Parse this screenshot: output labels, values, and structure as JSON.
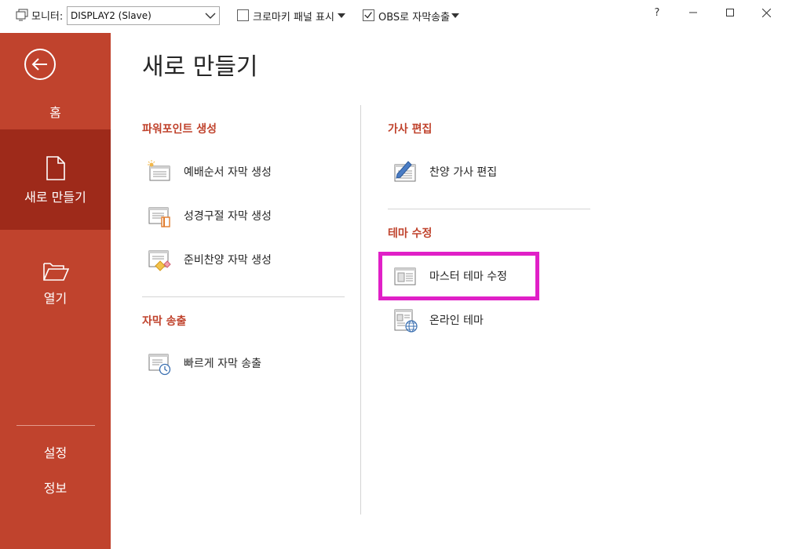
{
  "toolbar": {
    "monitor_label": "모니터:",
    "display_select": "DISPLAY2 (Slave)",
    "chroma_label": "크로마키 패널 표시",
    "chroma_checked": false,
    "obs_label": "OBS로 자막송출",
    "obs_checked": true,
    "icons": [
      "monitor-icon",
      "chevron-down-icon",
      "caret-down-icon"
    ]
  },
  "window": {
    "help": "?",
    "minimize": "minimize-icon",
    "maximize": "maximize-icon",
    "close": "close-icon"
  },
  "sidebar": {
    "back_icon": "back-arrow-icon",
    "home": "홈",
    "new": "새로 만들기",
    "open": "열기",
    "settings": "설정",
    "info": "정보"
  },
  "main": {
    "title": "새로 만들기",
    "sections": {
      "ppt": {
        "heading": "파워포인트 생성",
        "items": [
          "예배순서 자막 생성",
          "성경구절 자막 생성",
          "준비찬양 자막 생성"
        ]
      },
      "send": {
        "heading": "자막 송출",
        "items": [
          "빠르게 자막 송출"
        ]
      },
      "lyric": {
        "heading": "가사 편집",
        "items": [
          "찬양 가사 편집"
        ]
      },
      "theme": {
        "heading": "테마 수정",
        "items": [
          "마스터 테마 수정",
          "온라인 테마"
        ]
      }
    }
  },
  "colors": {
    "sidebar_bg": "#c0432d",
    "sidebar_active": "#9e2a1a",
    "section_heading": "#c0432d",
    "highlight": "#e020c7"
  }
}
